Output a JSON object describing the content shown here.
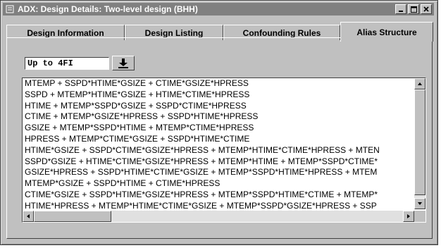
{
  "window": {
    "title": "ADX: Design Details: Two-level design (BHH)",
    "icon": "adx-app-icon",
    "controls": [
      "minimize-icon",
      "maximize-icon",
      "close-icon"
    ]
  },
  "tabs": [
    {
      "label": "Design Information",
      "active": false
    },
    {
      "label": "Design Listing",
      "active": false
    },
    {
      "label": "Confounding Rules",
      "active": false
    },
    {
      "label": "Alias Structure",
      "active": true
    }
  ],
  "alias_selector": {
    "value": "Up to 4FI",
    "button_icon": "download-arrow-icon"
  },
  "alias_list": {
    "lines": [
      "MTEMP + SSPD*HTIME*GSIZE + CTIME*GSIZE*HPRESS",
      "SSPD + MTEMP*HTIME*GSIZE + HTIME*CTIME*HPRESS",
      "HTIME + MTEMP*SSPD*GSIZE + SSPD*CTIME*HPRESS",
      "CTIME + MTEMP*GSIZE*HPRESS + SSPD*HTIME*HPRESS",
      "GSIZE + MTEMP*SSPD*HTIME + MTEMP*CTIME*HPRESS",
      "HPRESS + MTEMP*CTIME*GSIZE + SSPD*HTIME*CTIME",
      "HTIME*GSIZE + SSPD*CTIME*GSIZE*HPRESS + MTEMP*HTIME*CTIME*HPRESS + MTEN",
      "SSPD*GSIZE + HTIME*CTIME*GSIZE*HPRESS + MTEMP*HTIME + MTEMP*SSPD*CTIME*",
      "GSIZE*HPRESS + SSPD*HTIME*CTIME*GSIZE + MTEMP*SSPD*HTIME*HPRESS + MTEM",
      "MTEMP*GSIZE + SSPD*HTIME + CTIME*HPRESS",
      "CTIME*GSIZE + SSPD*HTIME*GSIZE*HPRESS + MTEMP*SSPD*HTIME*CTIME + MTEMP*",
      "HTIME*HPRESS + MTEMP*HTIME*CTIME*GSIZE + MTEMP*SSPD*GSIZE*HPRESS + SSP"
    ]
  }
}
